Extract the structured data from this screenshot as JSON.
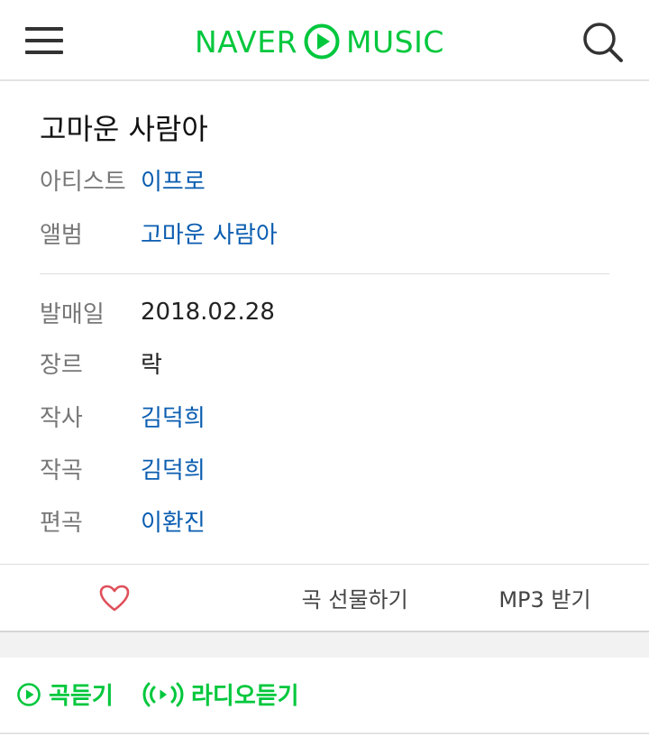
{
  "header": {
    "logo_left": "NAVER",
    "logo_right": "MUSIC",
    "brand_color": "#00c73c",
    "menu_icon": "hamburger-menu-icon",
    "search_icon": "search-icon"
  },
  "song": {
    "title": "고마운 사람아",
    "artist_label": "아티스트",
    "artist": "이프로",
    "album_label": "앨범",
    "album": "고마운 사람아"
  },
  "details": {
    "release_label": "발매일",
    "release": "2018.02.28",
    "genre_label": "장르",
    "genre": "락",
    "lyricist_label": "작사",
    "lyricist": "김덕희",
    "composer_label": "작곡",
    "composer": "김덕희",
    "arranger_label": "편곡",
    "arranger": "이환진"
  },
  "actions": {
    "like_icon": "heart-icon",
    "gift_label": "곡 선물하기",
    "mp3_label": "MP3 받기"
  },
  "listen": {
    "song_label": "곡듣기",
    "radio_label": "라디오듣기"
  },
  "colors": {
    "link": "#0a5db0",
    "heart": "#e0505a"
  }
}
